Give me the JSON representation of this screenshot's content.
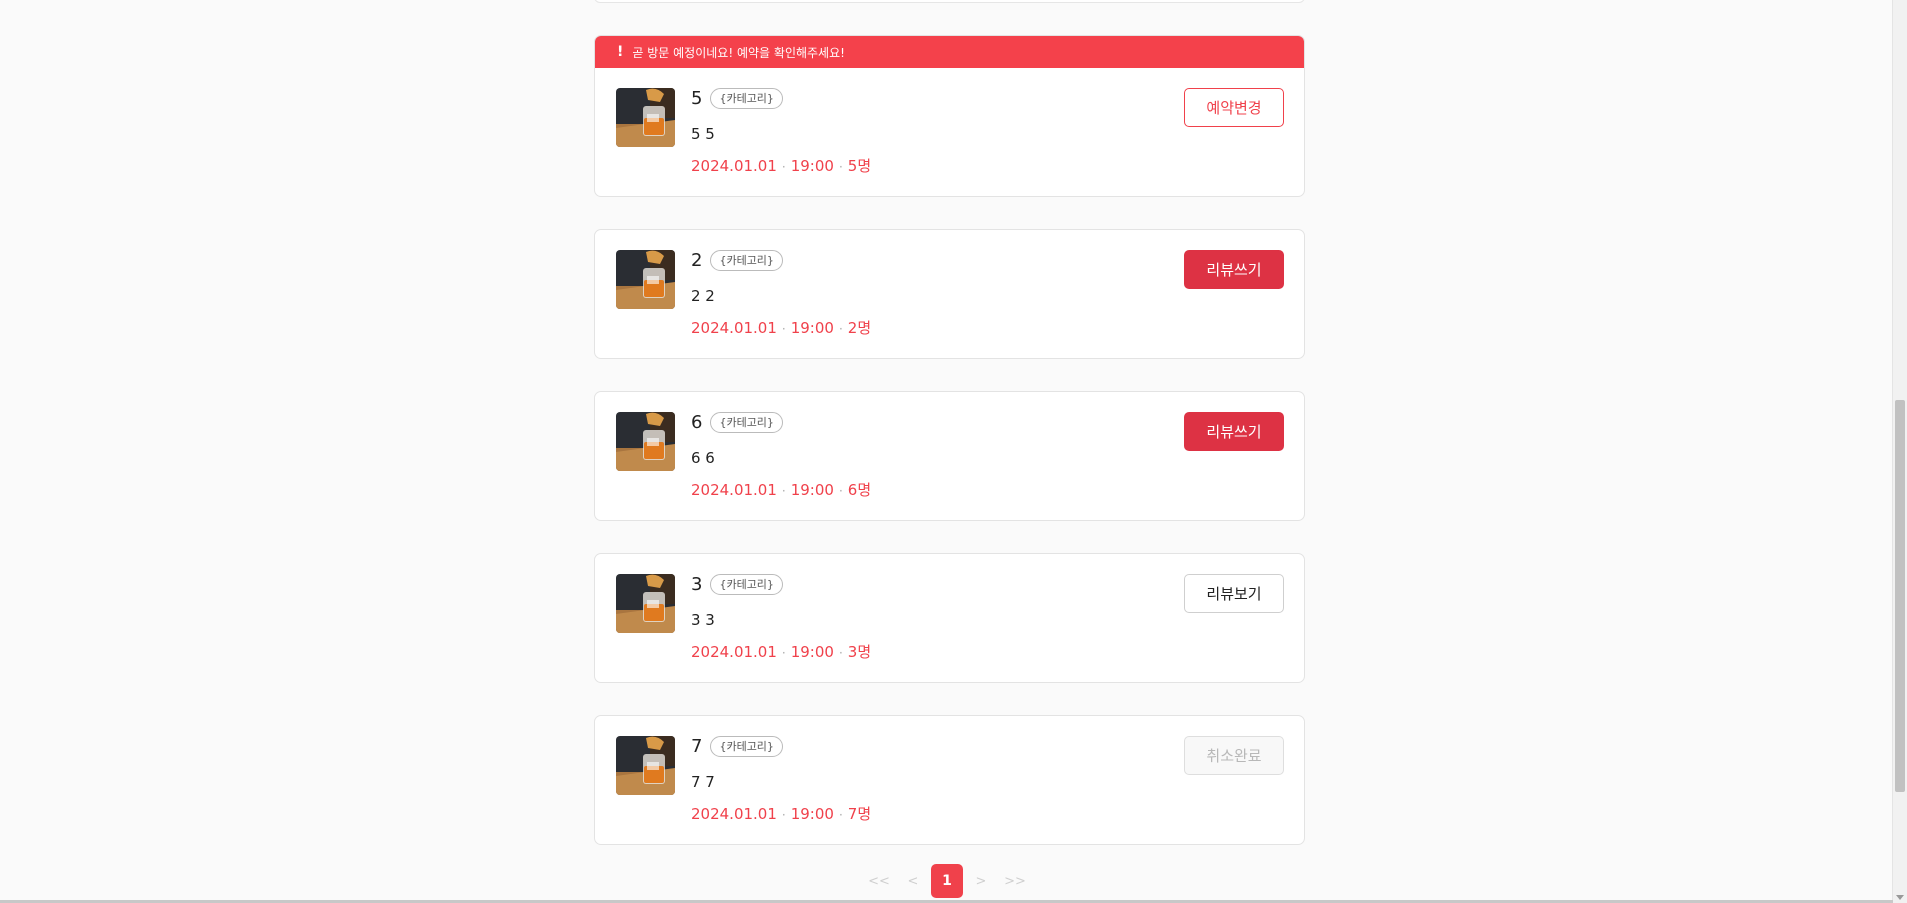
{
  "alert": {
    "icon": "exclamation-icon",
    "text": "곧 방문 예정이네요! 예약을 확인해주세요!"
  },
  "reservations": [
    {
      "title": "5",
      "category": "{카테고리}",
      "desc": "5 5",
      "date": "2024.01.01",
      "time": "19:00",
      "people": "5명",
      "action": "예약변경"
    },
    {
      "title": "2",
      "category": "{카테고리}",
      "desc": "2 2",
      "date": "2024.01.01",
      "time": "19:00",
      "people": "2명",
      "action": "리뷰쓰기"
    },
    {
      "title": "6",
      "category": "{카테고리}",
      "desc": "6 6",
      "date": "2024.01.01",
      "time": "19:00",
      "people": "6명",
      "action": "리뷰쓰기"
    },
    {
      "title": "3",
      "category": "{카테고리}",
      "desc": "3 3",
      "date": "2024.01.01",
      "time": "19:00",
      "people": "3명",
      "action": "리뷰보기"
    },
    {
      "title": "7",
      "category": "{카테고리}",
      "desc": "7 7",
      "date": "2024.01.01",
      "time": "19:00",
      "people": "7명",
      "action": "취소완료"
    }
  ],
  "pagination": {
    "first": "<<",
    "prev": "<",
    "current": "1",
    "next": ">",
    "last": ">>"
  },
  "colors": {
    "accent": "#f0414b",
    "review_button": "#dd3244"
  }
}
